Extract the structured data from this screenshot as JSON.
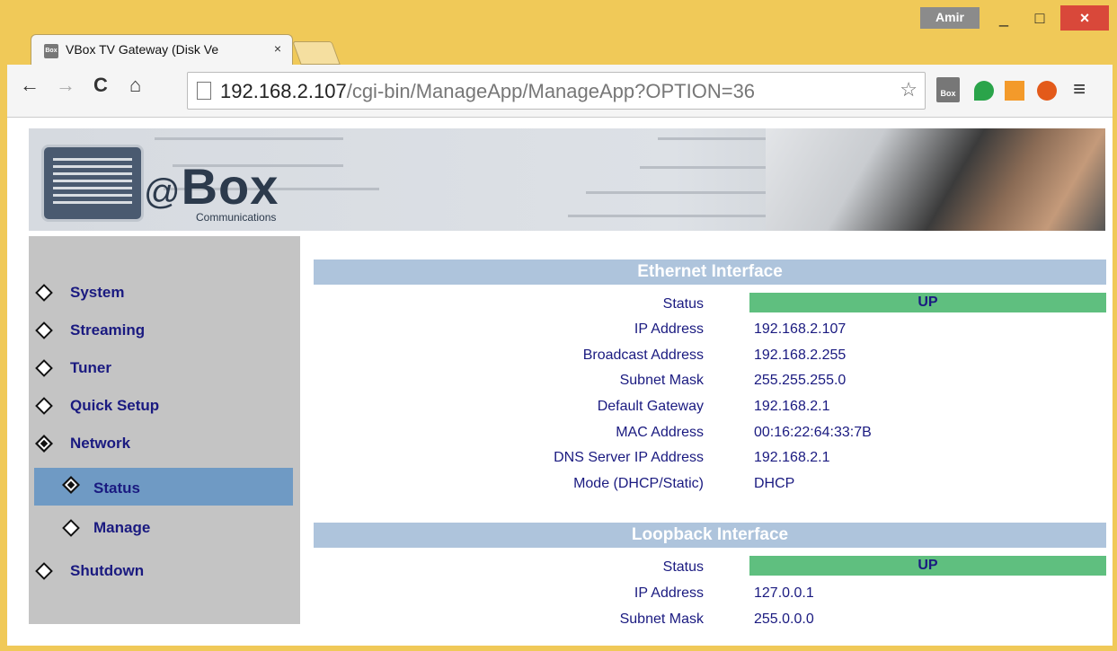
{
  "window": {
    "user": "Amir",
    "minimize": "_",
    "maximize": "□",
    "close": "×"
  },
  "tab": {
    "favicon": "Box",
    "title": "VBox TV Gateway (Disk Ve",
    "close": "×"
  },
  "toolbar": {
    "back": "←",
    "forward": "→",
    "reload": "C",
    "home": "⌂",
    "url_host": "192.168.2.107",
    "url_path": "/cgi-bin/ManageApp/ManageApp?OPTION=36",
    "star": "☆",
    "menu": "≡",
    "ext_vbox": "Box"
  },
  "banner": {
    "logo_at": "@",
    "logo_box": "Box",
    "logo_sub": "Communications"
  },
  "sidebar": {
    "items": [
      {
        "label": "System"
      },
      {
        "label": "Streaming"
      },
      {
        "label": "Tuner"
      },
      {
        "label": "Quick Setup"
      },
      {
        "label": "Network"
      },
      {
        "label": "Status"
      },
      {
        "label": "Manage"
      },
      {
        "label": "Shutdown"
      }
    ]
  },
  "ethernet": {
    "title": "Ethernet Interface",
    "rows": [
      {
        "label": "Status",
        "value": "UP"
      },
      {
        "label": "IP Address",
        "value": "192.168.2.107"
      },
      {
        "label": "Broadcast Address",
        "value": "192.168.2.255"
      },
      {
        "label": "Subnet Mask",
        "value": "255.255.255.0"
      },
      {
        "label": "Default Gateway",
        "value": "192.168.2.1"
      },
      {
        "label": "MAC Address",
        "value": "00:16:22:64:33:7B"
      },
      {
        "label": "DNS Server IP Address",
        "value": "192.168.2.1"
      },
      {
        "label": "Mode (DHCP/Static)",
        "value": "DHCP"
      }
    ]
  },
  "loopback": {
    "title": "Loopback Interface",
    "rows": [
      {
        "label": "Status",
        "value": "UP"
      },
      {
        "label": "IP Address",
        "value": "127.0.0.1"
      },
      {
        "label": "Subnet Mask",
        "value": "255.0.0.0"
      }
    ]
  }
}
